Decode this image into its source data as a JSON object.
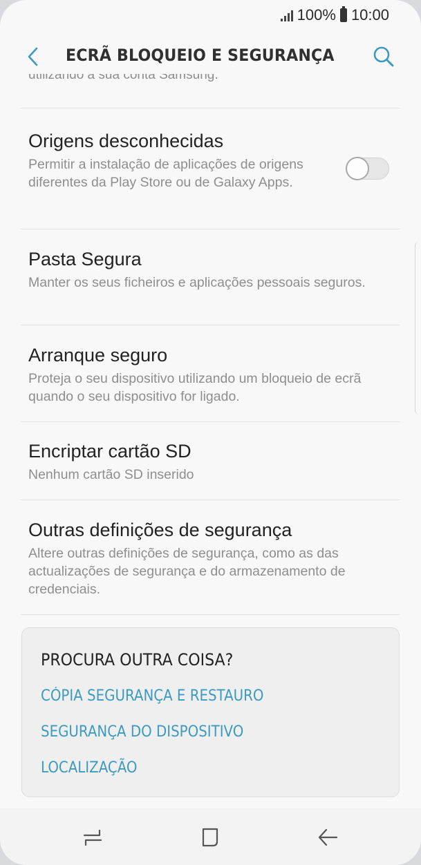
{
  "status": {
    "battery_percent": "100%",
    "time": "10:00"
  },
  "header": {
    "title": "ECRÃ BLOQUEIO E SEGURANÇA",
    "back_icon": "chevron-left-icon",
    "search_icon": "search-icon"
  },
  "truncated_text": "utilizando a sua conta Samsung.",
  "items": [
    {
      "title": "Origens desconhecidas",
      "description": "Permitir a instalação de aplicações de origens diferentes da Play Store ou de Galaxy Apps.",
      "toggle_on": false
    },
    {
      "title": "Pasta Segura",
      "description": "Manter os seus ficheiros e aplicações pessoais seguros."
    },
    {
      "title": "Arranque seguro",
      "description": "Proteja o seu dispositivo utilizando um bloqueio de ecrã quando o seu dispositivo for ligado."
    },
    {
      "title": "Encriptar cartão SD",
      "description": "Nenhum cartão SD inserido"
    },
    {
      "title": "Outras definições de segurança",
      "description": "Altere outras definições de segurança, como as das actualizações de segurança e do armazenamento de credenciais."
    }
  ],
  "suggestions": {
    "title": "PROCURA OUTRA COISA?",
    "links": [
      "CÓPIA SEGURANÇA E RESTAURO",
      "SEGURANÇA DO DISPOSITIVO",
      "LOCALIZAÇÃO"
    ]
  },
  "colors": {
    "accent": "#3c9abf",
    "background": "#f8f8f8"
  }
}
